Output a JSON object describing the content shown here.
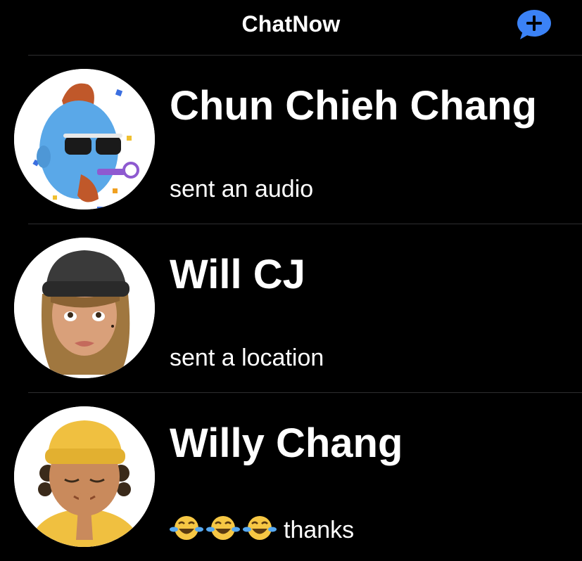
{
  "header": {
    "title": "ChatNow",
    "new_chat_icon": "plus-speech-bubble-icon",
    "accent_color": "#3b82f6"
  },
  "chats": [
    {
      "name": "Chun Chieh Chang",
      "preview": "sent an audio",
      "avatar_icon": "memoji-party-blower-sunglasses"
    },
    {
      "name": "Will CJ",
      "preview": "sent a location",
      "avatar_icon": "memoji-beanie-long-hair"
    },
    {
      "name": "Willy Chang",
      "preview_emojis": [
        "😂",
        "😂",
        "😂"
      ],
      "preview": "thanks",
      "avatar_icon": "memoji-yellow-beanie-praying-hands"
    }
  ]
}
